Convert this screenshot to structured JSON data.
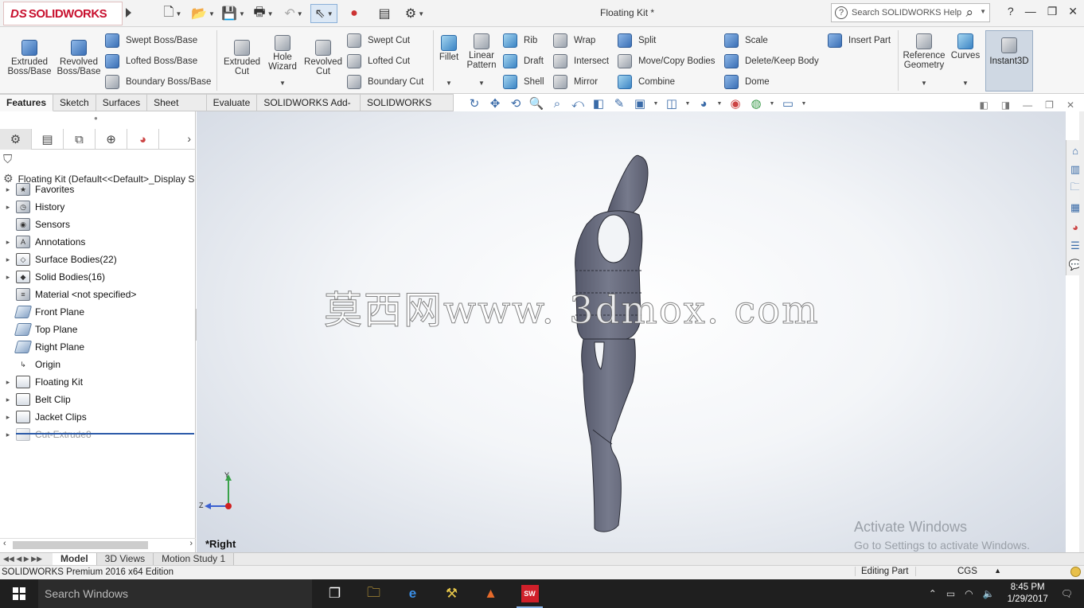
{
  "titlebar": {
    "logo_ds": "DS",
    "logo_text": "SOLIDWORKS",
    "document_title": "Floating Kit *",
    "search_placeholder": "Search SOLIDWORKS Help",
    "help_label": "?"
  },
  "ribbon": {
    "extruded_boss": "Extruded Boss/Base",
    "revolved_boss": "Revolved Boss/Base",
    "swept_boss": "Swept Boss/Base",
    "lofted_boss": "Lofted Boss/Base",
    "boundary_boss": "Boundary Boss/Base",
    "extruded_cut": "Extruded Cut",
    "hole_wizard": "Hole Wizard",
    "revolved_cut": "Revolved Cut",
    "swept_cut": "Swept Cut",
    "lofted_cut": "Lofted Cut",
    "boundary_cut": "Boundary Cut",
    "fillet": "Fillet",
    "linear_pattern": "Linear Pattern",
    "rib": "Rib",
    "draft": "Draft",
    "shell": "Shell",
    "wrap": "Wrap",
    "intersect": "Intersect",
    "mirror": "Mirror",
    "split": "Split",
    "move_copy": "Move/Copy Bodies",
    "combine": "Combine",
    "scale": "Scale",
    "delete_keep": "Delete/Keep Body",
    "dome": "Dome",
    "insert_part": "Insert Part",
    "reference_geometry": "Reference Geometry",
    "curves": "Curves",
    "instant3d": "Instant3D"
  },
  "tabs": [
    "Features",
    "Sketch",
    "Surfaces",
    "Sheet Metal",
    "Evaluate",
    "SOLIDWORKS Add-Ins",
    "SOLIDWORKS MBD"
  ],
  "tree": {
    "root": "Floating Kit  (Default<<Default>_Display S",
    "items": [
      {
        "label": "Favorites",
        "icon": "star-icon"
      },
      {
        "label": "History",
        "icon": "history-icon"
      },
      {
        "label": "Sensors",
        "icon": "sensor-icon"
      },
      {
        "label": "Annotations",
        "icon": "annotation-icon"
      },
      {
        "label": "Surface Bodies(22)",
        "icon": "surface-bodies-icon"
      },
      {
        "label": "Solid Bodies(16)",
        "icon": "solid-bodies-icon"
      },
      {
        "label": "Material <not specified>",
        "icon": "material-icon"
      },
      {
        "label": "Front Plane",
        "icon": "plane-icon"
      },
      {
        "label": "Top Plane",
        "icon": "plane-icon"
      },
      {
        "label": "Right Plane",
        "icon": "plane-icon"
      },
      {
        "label": "Origin",
        "icon": "origin-icon"
      },
      {
        "label": "Floating Kit",
        "icon": "folder-icon"
      },
      {
        "label": "Belt Clip",
        "icon": "folder-icon"
      },
      {
        "label": "Jacket Clips",
        "icon": "folder-icon"
      },
      {
        "label": "Cut-Extrude8",
        "icon": "cut-extrude-icon"
      }
    ]
  },
  "viewport": {
    "watermark": "莫西网www. 3dmox. com",
    "view_label": "*Right",
    "activate_title": "Activate Windows",
    "activate_sub": "Go to Settings to activate Windows.",
    "axis_y": "Y",
    "axis_z": "Z",
    "model_color": "#6b6e7d"
  },
  "model_tabs": [
    "Model",
    "3D Views",
    "Motion Study 1"
  ],
  "statusbar": {
    "product": "SOLIDWORKS Premium 2016 x64 Edition",
    "mode": "Editing Part",
    "units": "CGS"
  },
  "taskbar": {
    "search": "Search Windows",
    "time": "8:45 PM",
    "date": "1/29/2017",
    "sw_badge": "SW"
  }
}
